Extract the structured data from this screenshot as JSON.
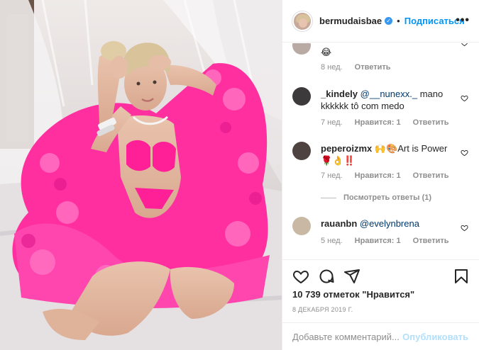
{
  "post": {
    "author": "bermudaisbae",
    "follow_label": "Подписаться",
    "dot": "•",
    "more_label": "•••",
    "verified_glyph": "✓"
  },
  "comments": [
    {
      "username": "",
      "text": "😂",
      "time": "8 нед.",
      "likes": "",
      "reply": "Ответить"
    },
    {
      "username": "_kindely",
      "mention": "@__nunexx._",
      "text": " mano kkkkkk tô com medo",
      "time": "7 нед.",
      "likes": "Нравится: 1",
      "reply": "Ответить"
    },
    {
      "username": "peperoizmx",
      "text": "🙌🎨Art is Power 🌹👌‼️",
      "time": "7 нед.",
      "likes": "Нравится: 1",
      "reply": "Ответить"
    },
    {
      "username": "rauanbn",
      "mention": "@evelynbrena",
      "text": "",
      "time": "5 нед.",
      "likes": "Нравится: 1",
      "reply": "Ответить"
    }
  ],
  "view_replies": "Посмотреть ответы (1)",
  "likes_count": "10 739 отметок \"Нравится\"",
  "date": "8 ДЕКАБРЯ 2019 Г.",
  "add_comment_placeholder": "Добавьте комментарий...",
  "publish_label": "Опубликовать",
  "icons": [
    "heart-icon",
    "comment-icon",
    "share-icon",
    "bookmark-icon",
    "more-icon"
  ],
  "colors": {
    "link": "#0095f6",
    "mention": "#00376b",
    "muted": "#8e8e8e",
    "publish_disabled": "#b2dffc",
    "pink": "#ff2fa0"
  }
}
